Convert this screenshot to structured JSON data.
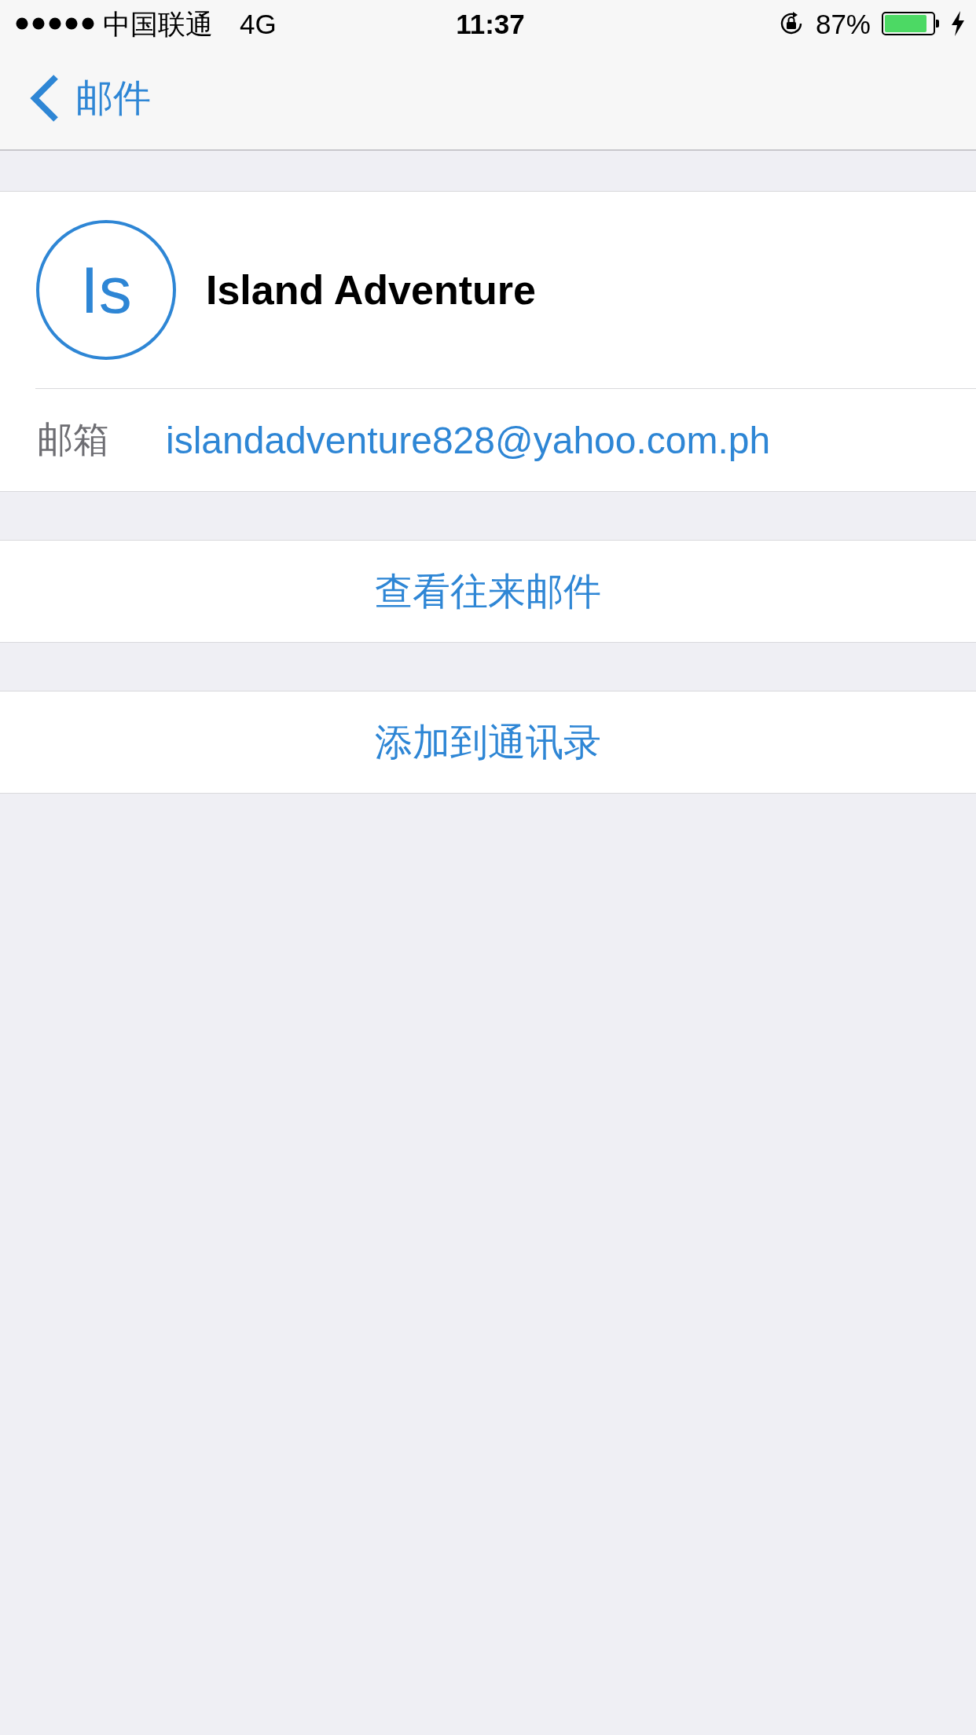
{
  "status_bar": {
    "carrier": "中国联通",
    "network": "4G",
    "time": "11:37",
    "battery": "87%"
  },
  "nav_bar": {
    "back_label": "邮件"
  },
  "contact": {
    "initials": "Is",
    "name": "Island Adventure",
    "fields": [
      {
        "label": "邮箱",
        "value": "islandadventure828@yahoo.com.ph"
      }
    ]
  },
  "actions": [
    {
      "label": "查看往来邮件"
    },
    {
      "label": "添加到通讯录"
    }
  ]
}
